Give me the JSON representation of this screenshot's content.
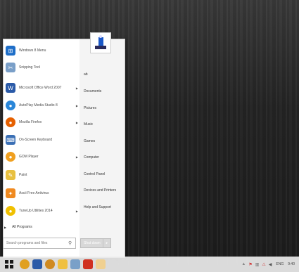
{
  "start_menu": {
    "programs": [
      {
        "label": "Windows 8 Menu",
        "icon": "windows-icon",
        "color": "#1e6ec8",
        "has_arrow": false
      },
      {
        "label": "Snipping Tool",
        "icon": "scissors-icon",
        "color": "#7a9fc8",
        "has_arrow": false
      },
      {
        "label": "Microsoft Office Word 2007",
        "icon": "word-icon",
        "color": "#2a5aa8",
        "has_arrow": true
      },
      {
        "label": "AutoPlay Media Studio 8",
        "icon": "autoplay-icon",
        "color": "#2a86d8",
        "has_arrow": true
      },
      {
        "label": "Mozilla Firefox",
        "icon": "firefox-icon",
        "color": "#e66000",
        "has_arrow": true
      },
      {
        "label": "On-Screen Keyboard",
        "icon": "keyboard-icon",
        "color": "#3a6fb5",
        "has_arrow": false
      },
      {
        "label": "GOM Player",
        "icon": "gom-player-icon",
        "color": "#f0a020",
        "has_arrow": true
      },
      {
        "label": "Paint",
        "icon": "paint-icon",
        "color": "#e8c040",
        "has_arrow": false
      },
      {
        "label": "Ascii Free Antivirus",
        "icon": "antivirus-icon",
        "color": "#f08a20",
        "has_arrow": false
      },
      {
        "label": "TuneUp Utilities 2014",
        "icon": "tuneup-icon",
        "color": "#f0c000",
        "has_arrow": true
      }
    ],
    "all_programs_label": "All Programs",
    "search_placeholder": "Search programs and files",
    "places": [
      "ab",
      "Documents",
      "Pictures",
      "Music",
      "Games",
      "Computer",
      "Control Panel",
      "Devices and Printers",
      "Help and Support"
    ],
    "shutdown_label": "Shut down",
    "shutdown_arrow": "▸"
  },
  "taskbar": {
    "items": [
      {
        "icon": "start-orb-icon",
        "color": "#1a1a1a"
      },
      {
        "icon": "media-player-icon",
        "color": "#e0a020"
      },
      {
        "icon": "folder-icon",
        "color": "#2a5aa8"
      },
      {
        "icon": "app-icon",
        "color": "#d08a20"
      },
      {
        "icon": "explorer-icon",
        "color": "#f0c040"
      },
      {
        "icon": "settings-icon",
        "color": "#7aa0c8"
      },
      {
        "icon": "acrobat-icon",
        "color": "#d03020"
      },
      {
        "icon": "file-icon",
        "color": "#f0d090"
      }
    ],
    "language": "ENG",
    "clock": "9:40"
  }
}
